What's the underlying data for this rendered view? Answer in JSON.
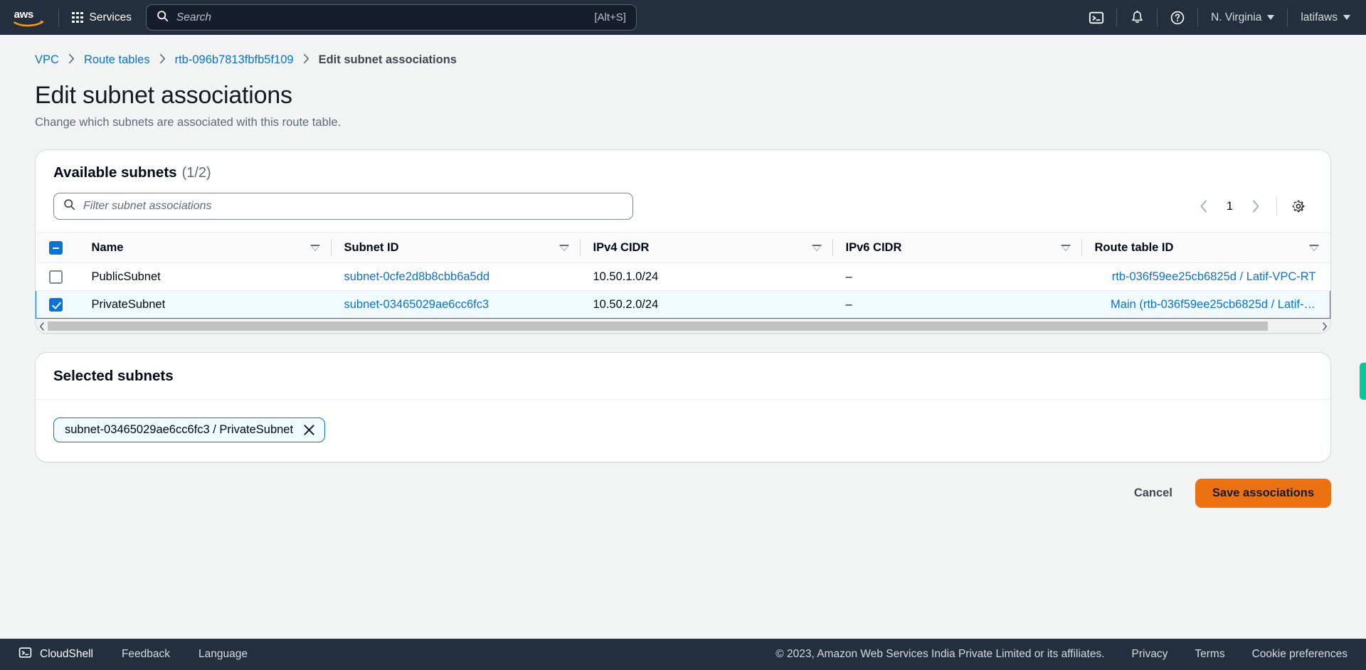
{
  "topnav": {
    "logo_alt": "aws",
    "services_label": "Services",
    "search": {
      "placeholder": "Search",
      "hint": "[Alt+S]"
    },
    "cloudshell_icon": "cloudshell-icon",
    "notifications_icon": "bell-icon",
    "help_icon": "question-circle-icon",
    "region_label": "N. Virginia",
    "account_label": "latifaws"
  },
  "breadcrumb": {
    "items": [
      {
        "label": "VPC",
        "link": true
      },
      {
        "label": "Route tables",
        "link": true
      },
      {
        "label": "rtb-096b7813fbfb5f109",
        "link": true
      },
      {
        "label": "Edit subnet associations",
        "link": false
      }
    ],
    "separator": "›"
  },
  "page": {
    "title": "Edit subnet associations",
    "description": "Change which subnets are associated with this route table."
  },
  "available": {
    "title": "Available subnets",
    "count": "(1/2)",
    "filter_placeholder": "Filter subnet associations",
    "pagination": {
      "prev_icon": "chevron-left-icon",
      "page": "1",
      "next_icon": "chevron-right-icon"
    },
    "settings_icon": "gear-icon",
    "columns": [
      "Name",
      "Subnet ID",
      "IPv4 CIDR",
      "IPv6 CIDR",
      "Route table ID"
    ],
    "rows": [
      {
        "selected": false,
        "name": "PublicSubnet",
        "subnet_id": "subnet-0cfe2d8b8cbb6a5dd",
        "ipv4_cidr": "10.50.1.0/24",
        "ipv6_cidr": "–",
        "route_table_id": "rtb-036f59ee25cb6825d / Latif-VPC-RT"
      },
      {
        "selected": true,
        "name": "PrivateSubnet",
        "subnet_id": "subnet-03465029ae6cc6fc3",
        "ipv4_cidr": "10.50.2.0/24",
        "ipv6_cidr": "–",
        "route_table_id": "Main (rtb-036f59ee25cb6825d / Latif-…"
      }
    ]
  },
  "selected_subnets": {
    "title": "Selected subnets",
    "tokens": [
      {
        "label": "subnet-03465029ae6cc6fc3 / PrivateSubnet",
        "remove_icon": "close-icon"
      }
    ]
  },
  "actions": {
    "cancel_label": "Cancel",
    "save_label": "Save associations"
  },
  "footer": {
    "cloudshell_label": "CloudShell",
    "feedback_label": "Feedback",
    "language_label": "Language",
    "copyright": "© 2023, Amazon Web Services India Private Limited or its affiliates.",
    "privacy_label": "Privacy",
    "terms_label": "Terms",
    "cookie_label": "Cookie preferences"
  },
  "colors": {
    "nav_bg": "#232f3e",
    "link": "#0972d3",
    "primary_button": "#ec7211",
    "selected_row_bg": "#f1faff",
    "side_tab": "#00c99b"
  }
}
